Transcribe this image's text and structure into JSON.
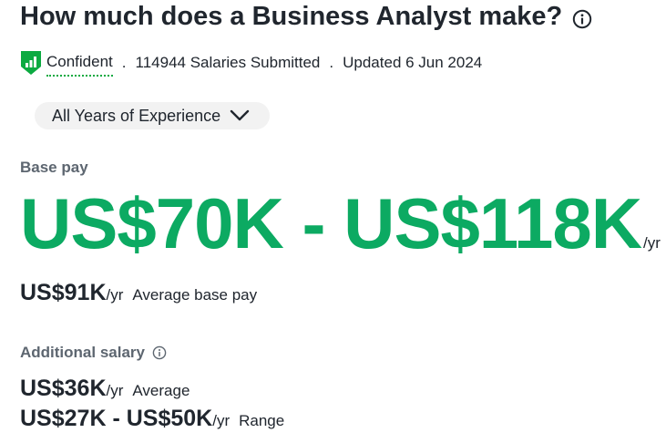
{
  "header": {
    "title": "How much does a Business Analyst make?"
  },
  "meta": {
    "confidence": "Confident",
    "separator": ".",
    "salaries_submitted": "114944 Salaries Submitted",
    "updated": "Updated 6 Jun 2024"
  },
  "filter": {
    "experience_label": "All Years of Experience"
  },
  "base_pay": {
    "label": "Base pay",
    "range": "US$70K - US$118K",
    "range_unit": "/yr",
    "average_amount": "US$91K",
    "average_unit": "/yr",
    "average_label": "Average base pay"
  },
  "additional_salary": {
    "label": "Additional salary",
    "average_amount": "US$36K",
    "average_unit": "/yr",
    "average_label": "Average",
    "range_amount": "US$27K - US$50K",
    "range_unit": "/yr",
    "range_label": "Range"
  },
  "colors": {
    "accent_green": "#0caa62",
    "confidence_green": "#0caa41",
    "text": "#20262e",
    "muted": "#5d6670"
  },
  "icons": {
    "title_info": "info-circle-icon",
    "confidence": "shield-bars-icon",
    "dropdown": "chevron-down-icon",
    "additional_info": "info-circle-icon"
  }
}
